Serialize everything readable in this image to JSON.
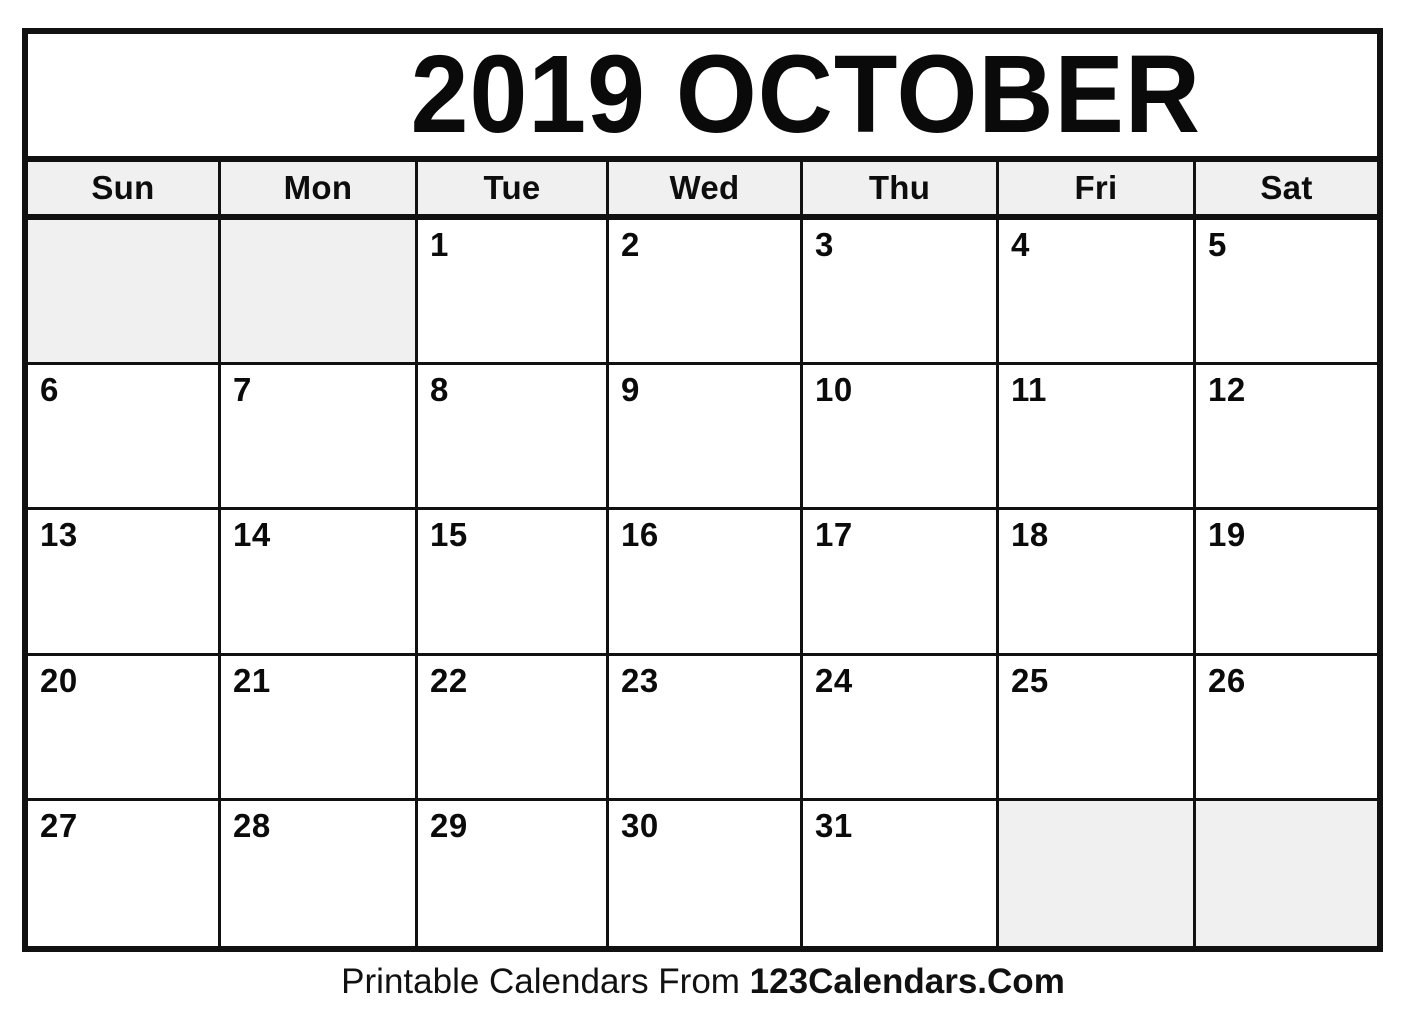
{
  "calendar": {
    "title": "2019 OCTOBER",
    "year": "2019",
    "month": "OCTOBER",
    "weekday_headers": [
      "Sun",
      "Mon",
      "Tue",
      "Wed",
      "Thu",
      "Fri",
      "Sat"
    ],
    "weeks": [
      [
        {
          "day": "",
          "blank": true
        },
        {
          "day": "",
          "blank": true
        },
        {
          "day": "1",
          "blank": false
        },
        {
          "day": "2",
          "blank": false
        },
        {
          "day": "3",
          "blank": false
        },
        {
          "day": "4",
          "blank": false
        },
        {
          "day": "5",
          "blank": false
        }
      ],
      [
        {
          "day": "6",
          "blank": false
        },
        {
          "day": "7",
          "blank": false
        },
        {
          "day": "8",
          "blank": false
        },
        {
          "day": "9",
          "blank": false
        },
        {
          "day": "10",
          "blank": false
        },
        {
          "day": "11",
          "blank": false
        },
        {
          "day": "12",
          "blank": false
        }
      ],
      [
        {
          "day": "13",
          "blank": false
        },
        {
          "day": "14",
          "blank": false
        },
        {
          "day": "15",
          "blank": false
        },
        {
          "day": "16",
          "blank": false
        },
        {
          "day": "17",
          "blank": false
        },
        {
          "day": "18",
          "blank": false
        },
        {
          "day": "19",
          "blank": false
        }
      ],
      [
        {
          "day": "20",
          "blank": false
        },
        {
          "day": "21",
          "blank": false
        },
        {
          "day": "22",
          "blank": false
        },
        {
          "day": "23",
          "blank": false
        },
        {
          "day": "24",
          "blank": false
        },
        {
          "day": "25",
          "blank": false
        },
        {
          "day": "26",
          "blank": false
        }
      ],
      [
        {
          "day": "27",
          "blank": false
        },
        {
          "day": "28",
          "blank": false
        },
        {
          "day": "29",
          "blank": false
        },
        {
          "day": "30",
          "blank": false
        },
        {
          "day": "31",
          "blank": false
        },
        {
          "day": "",
          "blank": true
        },
        {
          "day": "",
          "blank": true
        }
      ]
    ]
  },
  "footer": {
    "prefix": "Printable Calendars From ",
    "brand": "123Calendars.Com"
  },
  "colors": {
    "ink": "#111111",
    "blank_cell": "#f0f0f0",
    "header_band": "#f0f0f0",
    "page_background": "#ffffff"
  }
}
